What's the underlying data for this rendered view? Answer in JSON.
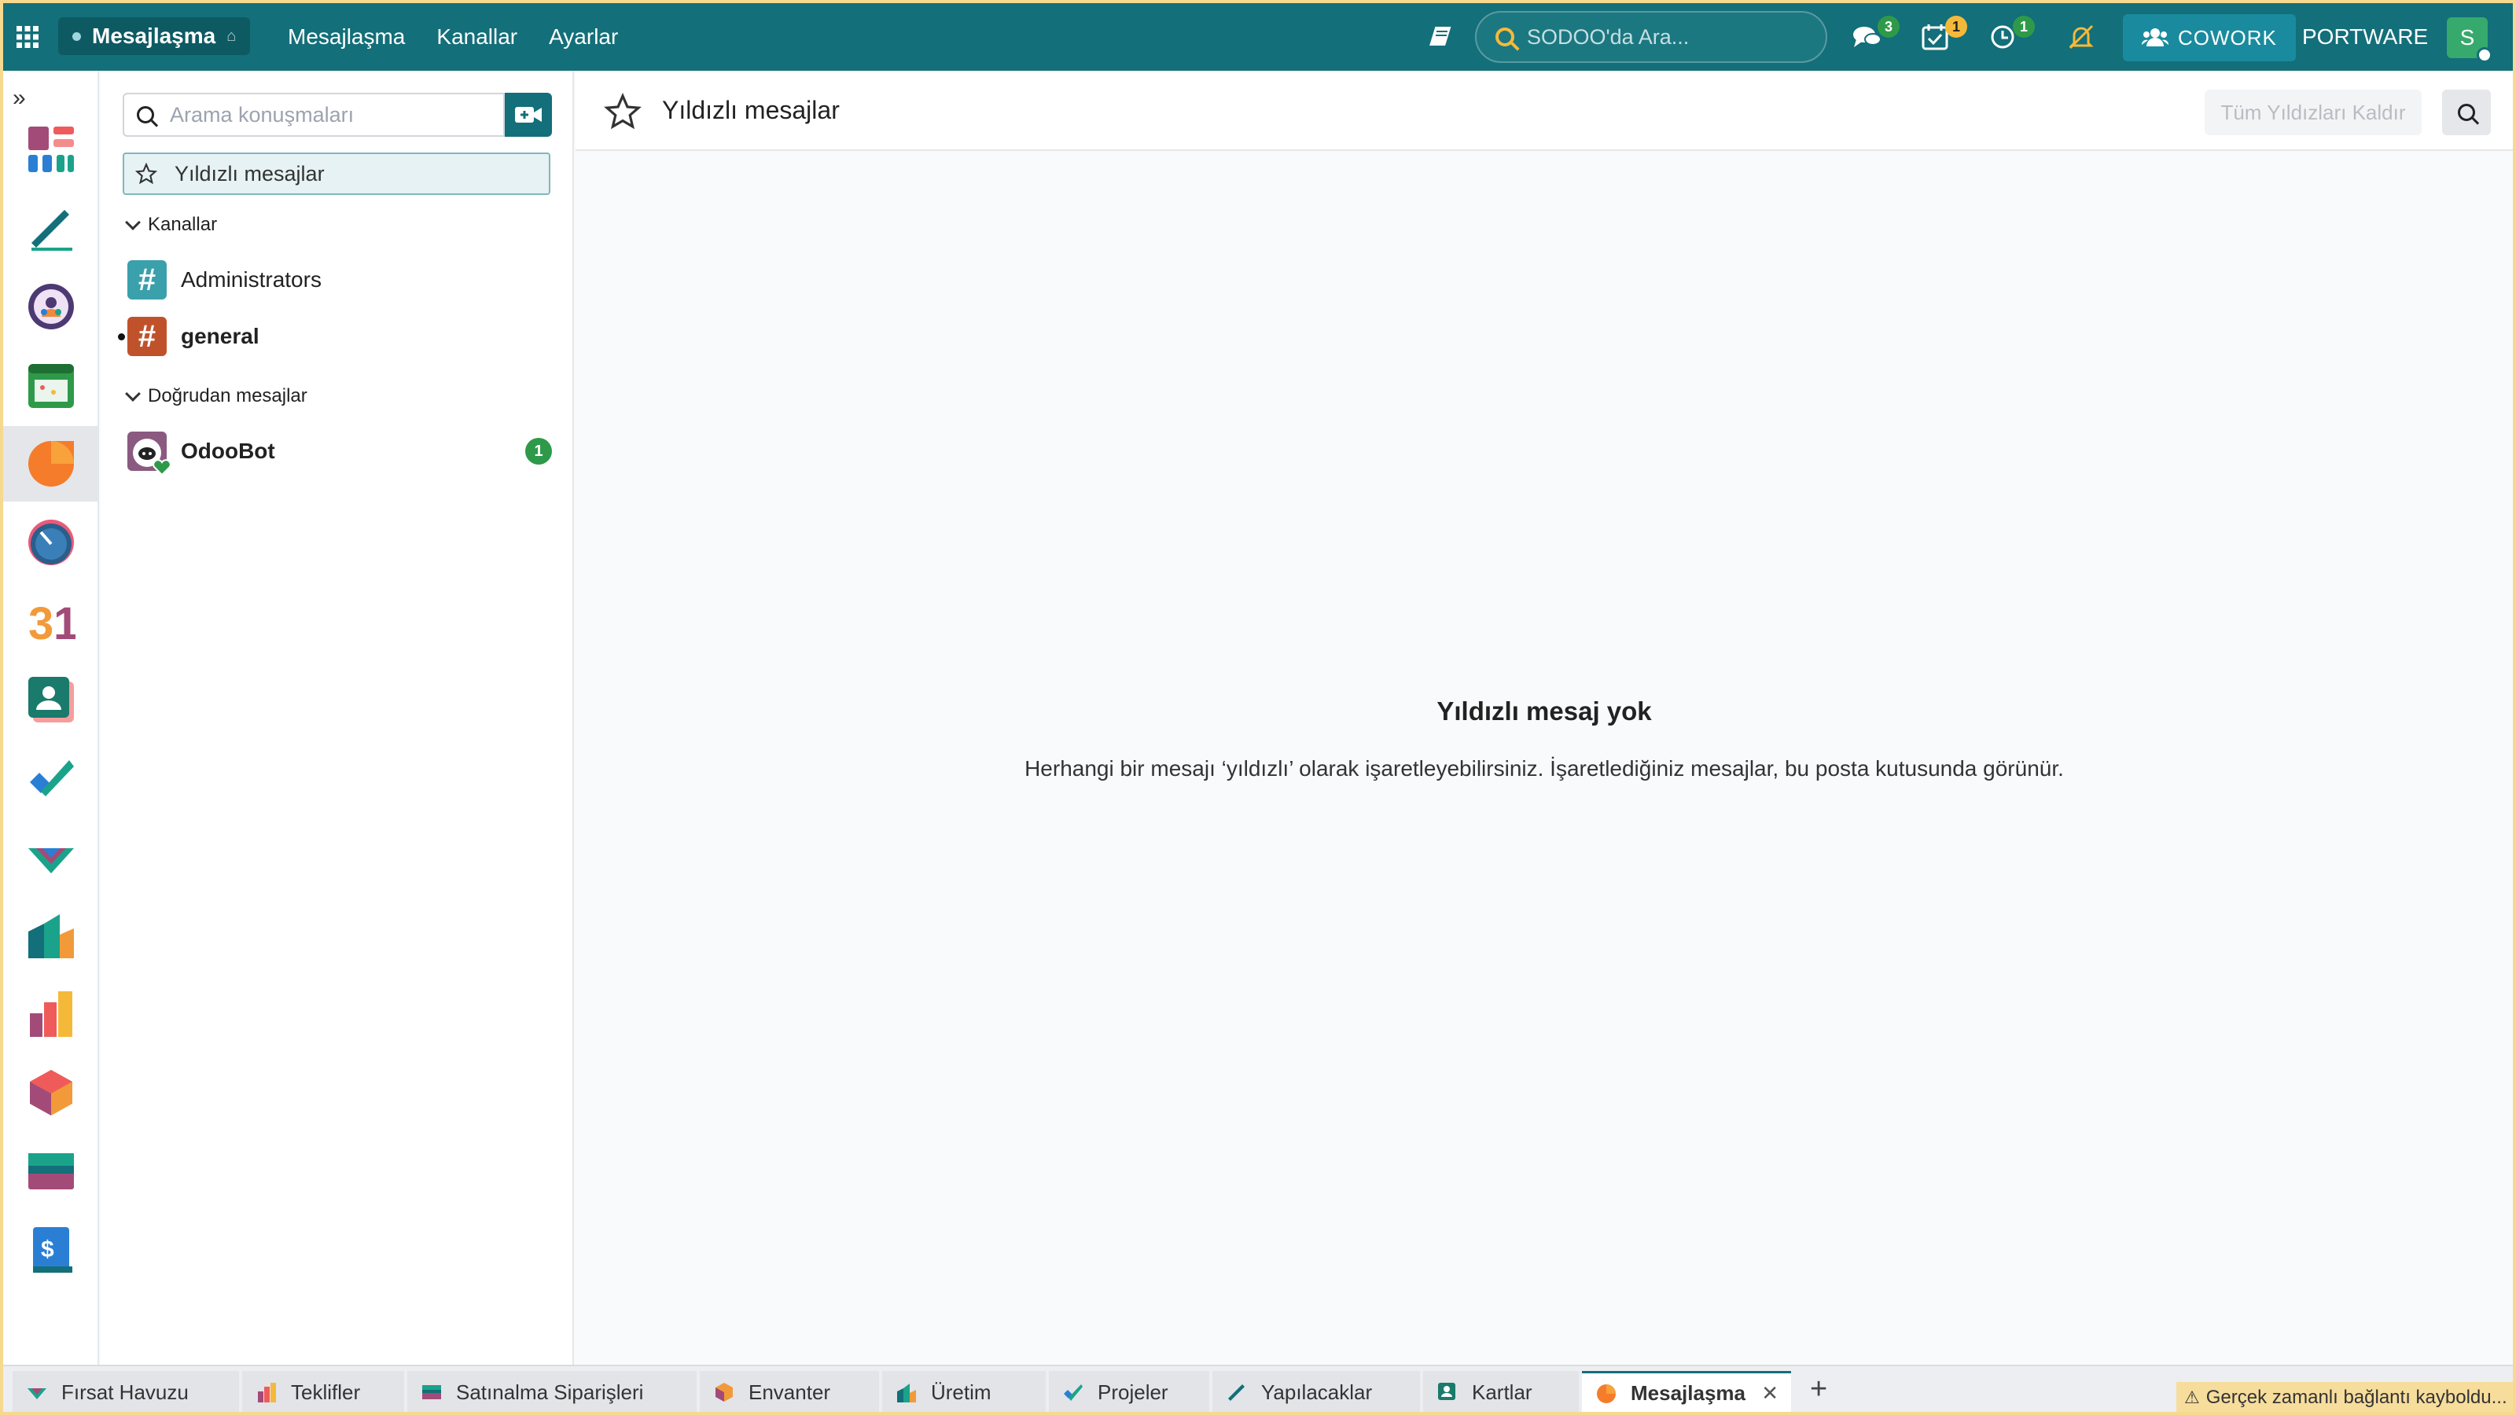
{
  "topbar": {
    "brand": "Mesajlaşma",
    "nav": [
      "Mesajlaşma",
      "Kanallar",
      "Ayarlar"
    ],
    "search_placeholder": "SODOO'da Ara...",
    "badges": {
      "messages": "3",
      "activities": "1",
      "timeoff": "1"
    },
    "cowork": "COWORK",
    "company": "PORTWARE",
    "avatar_initial": "S"
  },
  "sidebar_icons": [
    "dashboard-icon",
    "todo-pen-icon",
    "people-circle-icon",
    "calendar-app-icon",
    "discuss-icon",
    "timesheet-dial-icon",
    "calendar-31-icon",
    "contacts-icon",
    "project-check-icon",
    "crm-handshake-icon",
    "manufacturing-icon",
    "sales-bars-icon",
    "inventory-box-icon",
    "purchase-card-icon",
    "invoice-icon"
  ],
  "panel": {
    "search_placeholder": "Arama konuşmaları",
    "starred_label": "Yıldızlı mesajlar",
    "channels_header": "Kanallar",
    "channels": [
      {
        "name": "Administrators",
        "color": "#3aa0ab"
      },
      {
        "name": "general",
        "color": "#c0522b"
      }
    ],
    "dm_header": "Doğrudan mesajlar",
    "dms": [
      {
        "name": "OdooBot",
        "count": "1"
      }
    ]
  },
  "main": {
    "title": "Yıldızlı mesajlar",
    "unstar_all": "Tüm Yıldızları Kaldır",
    "empty_title": "Yıldızlı mesaj yok",
    "empty_text": "Herhangi bir mesajı ‘yıldızlı’ olarak işaretleyebilirsiniz. İşaretlediğiniz mesajlar, bu posta kutusunda görünür."
  },
  "tabs": [
    "Fırsat Havuzu",
    "Teklifler",
    "Satınalma Siparişleri",
    "Envanter",
    "Üretim",
    "Projeler",
    "Yapılacaklar",
    "Kartlar",
    "Mesajlaşma"
  ],
  "connection_warning": "Gerçek zamanlı bağlantı kayboldu...",
  "colors": {
    "accent": "#136f79",
    "success": "#2e9a49",
    "warning": "#f7dd9c"
  }
}
